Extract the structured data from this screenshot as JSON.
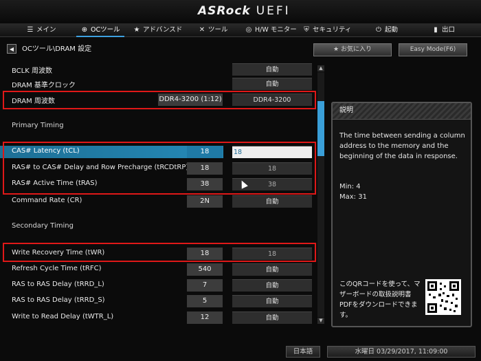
{
  "brand": {
    "logo": "ASRock",
    "suffix": "UEFI"
  },
  "tabs": [
    {
      "icon": "list-icon",
      "glyph": "☰",
      "label": "メイン",
      "active": false
    },
    {
      "icon": "oc-icon",
      "glyph": "⊕",
      "label": "OCツール",
      "active": true
    },
    {
      "icon": "star-icon",
      "glyph": "★",
      "label": "アドバンスド",
      "active": false
    },
    {
      "icon": "tools-icon",
      "glyph": "✕",
      "label": "ツール",
      "active": false
    },
    {
      "icon": "monitor-icon",
      "glyph": "◎",
      "label": "H/W モニター",
      "active": false
    },
    {
      "icon": "shield-icon",
      "glyph": "⛨",
      "label": "セキュリティ",
      "active": false
    },
    {
      "icon": "power-icon",
      "glyph": "⏻",
      "label": "起動",
      "active": false
    },
    {
      "icon": "exit-icon",
      "glyph": "▮",
      "label": "出口",
      "active": false
    }
  ],
  "breadcrumb": "OCツール\\DRAM 設定",
  "buttons": {
    "favorites": "お気に入り",
    "easy_mode": "Easy Mode(F6)"
  },
  "sections": {
    "primary": "Primary Timing",
    "secondary": "Secondary Timing"
  },
  "rows": {
    "bclk": {
      "label": "BCLK 周波数",
      "value": "自動"
    },
    "dram_ref": {
      "label": "DRAM 基準クロック",
      "value": "自動"
    },
    "dram_freq": {
      "label": "DRAM 周波数",
      "current": "DDR4-3200 (1:12)",
      "value": "DDR4-3200"
    },
    "tcl": {
      "label": "CAS# Latency (tCL)",
      "current": "18",
      "value": "18"
    },
    "trcdtrp": {
      "label": "RAS# to CAS# Delay and Row Precharge (tRCDtRP)",
      "current": "18",
      "value": "18"
    },
    "tras": {
      "label": "RAS# Active Time (tRAS)",
      "current": "38",
      "value": "38"
    },
    "cr": {
      "label": "Command Rate (CR)",
      "current": "2N",
      "value": "自動"
    },
    "twr": {
      "label": "Write Recovery Time (tWR)",
      "current": "18",
      "value": "18"
    },
    "trfc": {
      "label": "Refresh Cycle Time (tRFC)",
      "current": "540",
      "value": "自動"
    },
    "trrd_l": {
      "label": "RAS to RAS Delay (tRRD_L)",
      "current": "7",
      "value": "自動"
    },
    "trrd_s": {
      "label": "RAS to RAS Delay (tRRD_S)",
      "current": "5",
      "value": "自動"
    },
    "twtr_l": {
      "label": "Write to Read Delay (tWTR_L)",
      "current": "12",
      "value": "自動"
    }
  },
  "help": {
    "title": "説明",
    "text": "The time between sending a column address to the memory and the beginning of the data in response.",
    "min": "Min: 4",
    "max": "Max: 31",
    "qr_text": "このQRコードを使って、マザーボードの取扱説明書PDFをダウンロードできます。"
  },
  "status": {
    "language": "日本語",
    "datetime": "水曜日 03/29/2017, 11:09:00"
  },
  "colors": {
    "accent": "#3ea0e0",
    "selection": "#258ab8",
    "highlight": "#e01818"
  }
}
